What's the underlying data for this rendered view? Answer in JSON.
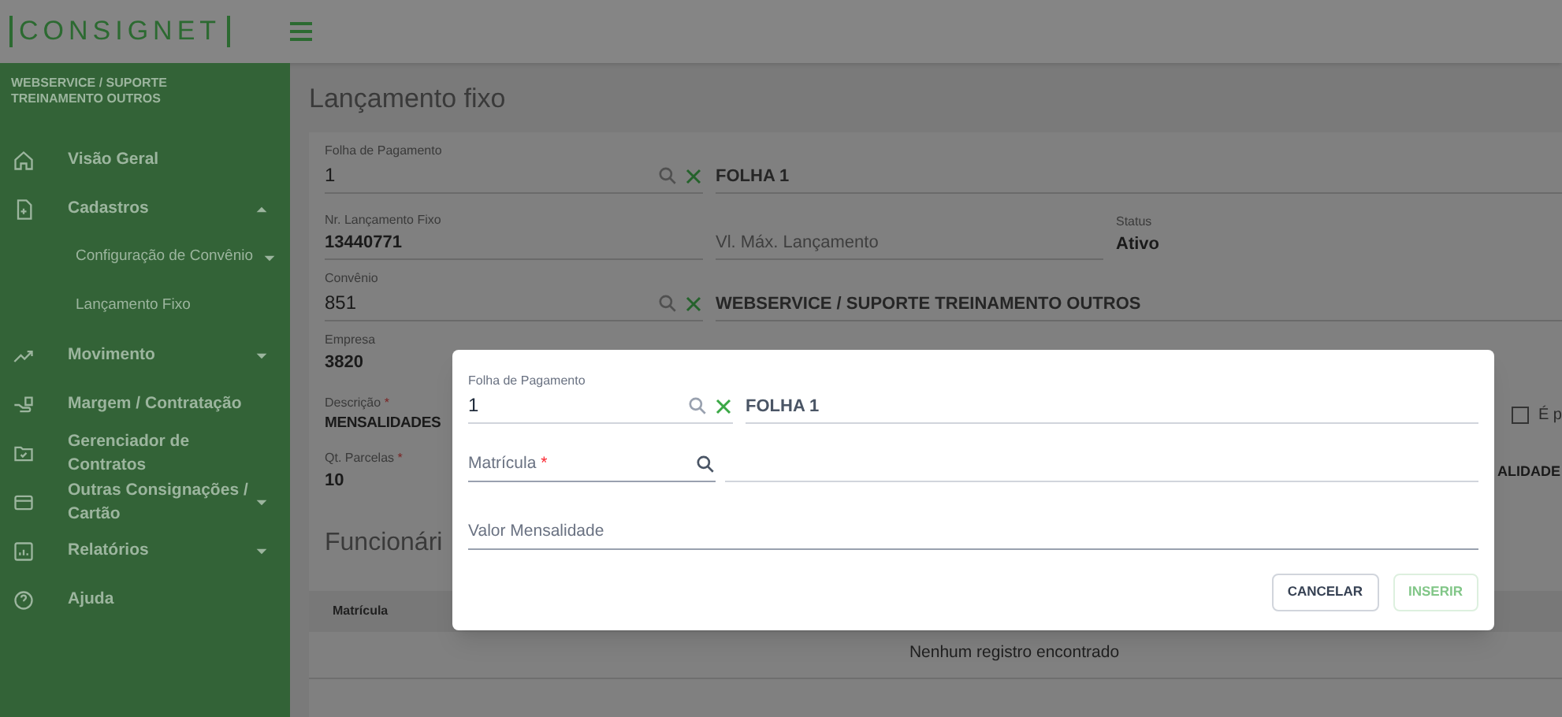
{
  "header": {
    "logo": "CONSIGNET"
  },
  "sidebar": {
    "organization": "WEBSERVICE / SUPORTE TREINAMENTO OUTROS",
    "items": [
      {
        "label": "Visão Geral",
        "kind": "home"
      },
      {
        "label": "Cadastros",
        "kind": "file",
        "expanded": true,
        "children": [
          {
            "label": "Configuração de Convênio",
            "expanded": false
          },
          {
            "label": "Lançamento Fixo"
          }
        ]
      },
      {
        "label": "Movimento",
        "kind": "trend",
        "expanded": false
      },
      {
        "label": "Margem / Contratação",
        "kind": "hand"
      },
      {
        "label": "Gerenciador de Contratos",
        "kind": "folder"
      },
      {
        "label": "Outras Consignações / Cartão",
        "kind": "card",
        "expanded": false
      },
      {
        "label": "Relatórios",
        "kind": "chart",
        "expanded": false
      },
      {
        "label": "Ajuda",
        "kind": "help"
      }
    ]
  },
  "page": {
    "title": "Lançamento fixo",
    "folha": {
      "label": "Folha de Pagamento",
      "value": "1",
      "description": "FOLHA 1"
    },
    "numero": {
      "label": "Nr. Lançamento Fixo",
      "value": "13440771"
    },
    "valor_maximo": {
      "placeholder": "Vl. Máx. Lançamento"
    },
    "status": {
      "label": "Status",
      "value": "Ativo"
    },
    "convenio": {
      "label": "Convênio",
      "value": "851",
      "description": "WEBSERVICE / SUPORTE TREINAMENTO OUTROS"
    },
    "empresa": {
      "label": "Empresa",
      "value": "3820"
    },
    "descricao": {
      "label": "Descrição",
      "required_mark": "*",
      "value": "MENSALIDADES"
    },
    "checkbox": {
      "label": "É p",
      "checked": false
    },
    "parcelas": {
      "label": "Qt. Parcelas",
      "required_mark": "*",
      "value": "10"
    },
    "column_3": {
      "value": "ALIDADE"
    },
    "section_title": "Funcionári",
    "table": {
      "columns": [
        "Matrícula"
      ],
      "empty_text": "Nenhum registro encontrado"
    }
  },
  "dialog": {
    "folha": {
      "label": "Folha de Pagamento",
      "value": "1",
      "description": "FOLHA 1"
    },
    "matricula": {
      "placeholder": "Matrícula",
      "required_mark": "*"
    },
    "valor": {
      "placeholder": "Valor Mensalidade"
    },
    "buttons": [
      {
        "label": "CANCELAR",
        "kind": "secondary",
        "disabled": false
      },
      {
        "label": "INSERIR",
        "kind": "primary",
        "disabled": true
      }
    ]
  }
}
